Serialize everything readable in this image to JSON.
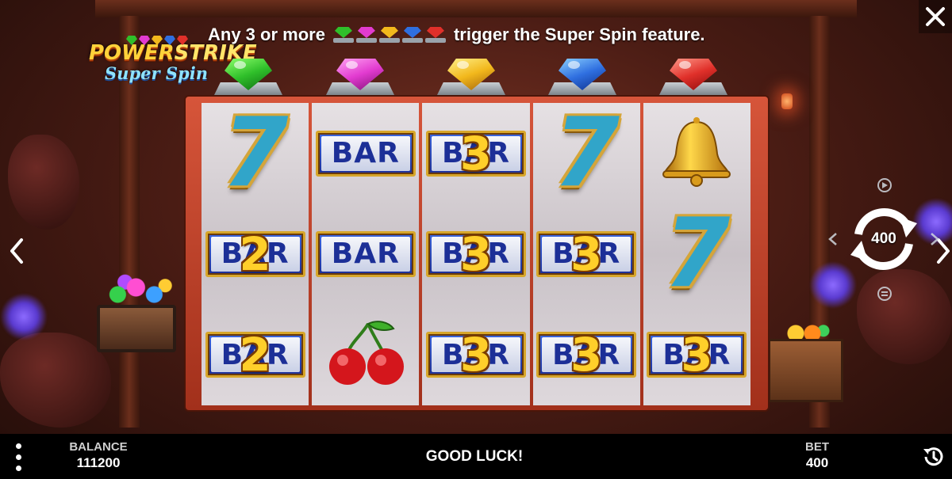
{
  "header": {
    "logo_line1_a": "POWER",
    "logo_line1_b": "STRIKE",
    "logo_line2": "Super Spin",
    "info_before": "Any 3 or more",
    "info_after": "trigger the Super Spin feature."
  },
  "gems": [
    {
      "name": "green-gem",
      "color": "#2fbf2a"
    },
    {
      "name": "pink-gem",
      "color": "#e23bd0"
    },
    {
      "name": "yellow-gem",
      "color": "#f2b81c"
    },
    {
      "name": "blue-gem",
      "color": "#2f6fe0"
    },
    {
      "name": "red-gem",
      "color": "#e0302a"
    }
  ],
  "reels": [
    [
      {
        "symbol": "seven",
        "text": "7"
      },
      {
        "symbol": "bar2",
        "text": "BAR",
        "big": "2"
      },
      {
        "symbol": "bar2",
        "text": "BAR",
        "big": "2"
      }
    ],
    [
      {
        "symbol": "bar",
        "text": "BAR"
      },
      {
        "symbol": "bar",
        "text": "BAR"
      },
      {
        "symbol": "cherry",
        "text": ""
      }
    ],
    [
      {
        "symbol": "bar3",
        "text": "BAR",
        "big": "3"
      },
      {
        "symbol": "bar3",
        "text": "BAR",
        "big": "3"
      },
      {
        "symbol": "bar3",
        "text": "BAR",
        "big": "3"
      }
    ],
    [
      {
        "symbol": "seven",
        "text": "7"
      },
      {
        "symbol": "bar3",
        "text": "BAR",
        "big": "3"
      },
      {
        "symbol": "bar3",
        "text": "BAR",
        "big": "3"
      }
    ],
    [
      {
        "symbol": "bell",
        "text": ""
      },
      {
        "symbol": "seven",
        "text": "7"
      },
      {
        "symbol": "bar3",
        "text": "BAR",
        "big": "3"
      }
    ]
  ],
  "controls": {
    "spin_value": "400",
    "icons": [
      "close-icon",
      "chevron-left-icon",
      "chevron-right-icon",
      "autoplay-icon",
      "spin-icon",
      "minus-icon",
      "plus-icon",
      "menu-icon",
      "history-icon"
    ]
  },
  "footer": {
    "balance_label": "BALANCE",
    "balance_value": "111200",
    "message": "GOOD LUCK!",
    "bet_label": "BET",
    "bet_value": "400"
  },
  "colors": {
    "reel_frame": "#c4432b",
    "bar_blue": "#1c2f97",
    "gold": "#ffcf2a",
    "seven_blue": "#31a5c9"
  }
}
